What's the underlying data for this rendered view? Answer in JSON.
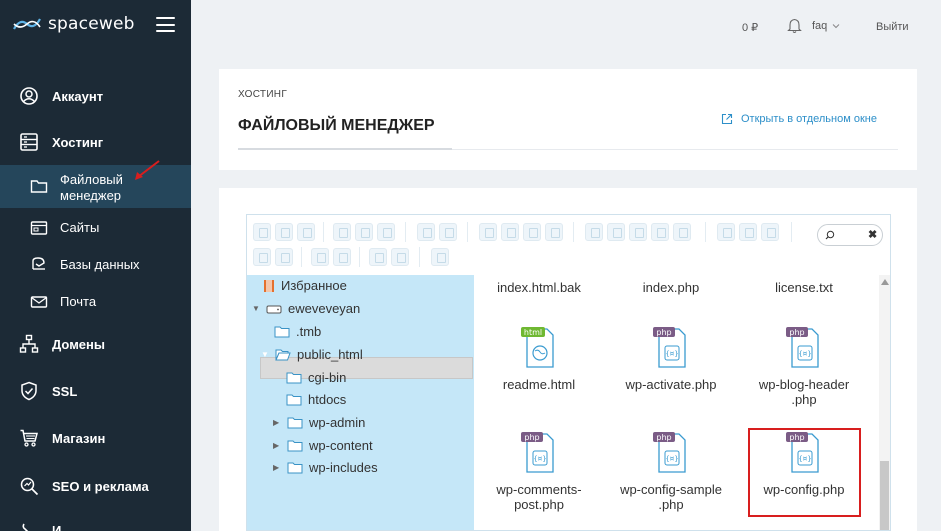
{
  "sidebar": {
    "logo_text": "spaceweb",
    "items": [
      {
        "label": "Аккаунт",
        "icon": "user-circle-icon"
      },
      {
        "label": "Хостинг",
        "icon": "server-icon"
      },
      {
        "label": "Домены",
        "icon": "sitemap-icon"
      },
      {
        "label": "SSL",
        "icon": "shield-icon"
      },
      {
        "label": "Магазин",
        "icon": "cart-icon"
      },
      {
        "label": "SEO и реклама",
        "icon": "magnifier-icon"
      },
      {
        "label": "И...",
        "icon": "tools-icon"
      }
    ],
    "hosting_sub": [
      {
        "label_line1": "Файловый",
        "label_line2": "менеджер",
        "icon": "folder-icon",
        "active": true
      },
      {
        "label": "Сайты",
        "icon": "sites-icon"
      },
      {
        "label": "Базы данных",
        "icon": "database-icon"
      },
      {
        "label": "Почта",
        "icon": "mail-icon"
      }
    ]
  },
  "topbar": {
    "balance": "0 ₽",
    "username": "faq",
    "logout": "Выйти"
  },
  "header": {
    "breadcrumb": "ХОСТИНГ",
    "title": "ФАЙЛОВЫЙ МЕНЕДЖЕР",
    "open_window": "Открыть в отдельном окне"
  },
  "tree": {
    "favorites": "Избранное",
    "root": "eweveveyan",
    "items": [
      ".tmb",
      "public_html",
      "cgi-bin",
      "htdocs",
      "wp-admin",
      "wp-content",
      "wp-includes"
    ]
  },
  "files": {
    "row0": [
      "index.html.bak",
      "index.php",
      "license.txt"
    ],
    "readme": {
      "name": "readme.html",
      "badge": "html"
    },
    "wp_activate": {
      "name": "wp-activate.php",
      "badge": "php"
    },
    "wp_blog_header": {
      "line1": "wp-blog-header",
      "line2": ".php",
      "badge": "php"
    },
    "wp_comments": {
      "line1": "wp-comments-",
      "line2": "post.php",
      "badge": "php"
    },
    "wp_config_sample": {
      "line1": "wp-config-sample",
      "line2": ".php",
      "badge": "php"
    },
    "wp_config": {
      "name": "wp-config.php",
      "badge": "php"
    }
  },
  "colors": {
    "sidebar_bg": "#1c2a36",
    "sidebar_active": "#25465b",
    "tree_bg": "#c5e7f8",
    "accent_link": "#2d8fc9",
    "highlight": "#d81e1e",
    "php_badge": "#7b5c86",
    "html_badge": "#6fb832"
  }
}
